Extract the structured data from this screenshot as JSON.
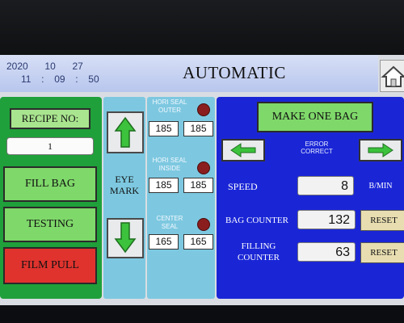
{
  "header": {
    "date": {
      "year": "2020",
      "month": "10",
      "day": "27"
    },
    "time": {
      "hour": "11",
      "sep1": ":",
      "minute": "09",
      "sep2": ":",
      "second": "50"
    },
    "title": "AUTOMATIC",
    "home_icon": "home-icon"
  },
  "left_panel": {
    "recipe_label": "RECIPE NO:",
    "recipe_value": "1",
    "fill_bag": "FILL BAG",
    "testing": "TESTING",
    "film_pull": "FILM PULL"
  },
  "eye_mark": {
    "label_line1": "EYE",
    "label_line2": "MARK",
    "up_icon": "arrow-up-icon",
    "down_icon": "arrow-down-icon"
  },
  "seal_panel": {
    "hori_outer_label_1": "HORI SEAL",
    "hori_outer_label_2": "OUTER",
    "hori_outer_values": [
      "185",
      "185"
    ],
    "hori_inside_label_1": "HORI SEAL",
    "hori_inside_label_2": "INSIDE",
    "hori_inside_values": [
      "185",
      "185"
    ],
    "center_label_1": "CENTER",
    "center_label_2": "SEAL",
    "center_values": [
      "165",
      "165"
    ]
  },
  "right_panel": {
    "make_one_bag": "MAKE ONE BAG",
    "error_correct_1": "ERROR",
    "error_correct_2": "CORRECT",
    "speed_label": "SPEED",
    "speed_value": "8",
    "speed_unit": "B/MIN",
    "bag_counter_label": "BAG COUNTER",
    "bag_counter_value": "132",
    "filling_counter_label_1": "FILLING",
    "filling_counter_label_2": "COUNTER",
    "filling_counter_value": "63",
    "reset_label": "RESET"
  },
  "colors": {
    "header": "#c4cff1",
    "left_panel": "#1fa03a",
    "eye_panel": "#7dc8e0",
    "right_panel": "#1a26d6",
    "film_pull": "#e0332e",
    "led": "#8a1e1e"
  }
}
